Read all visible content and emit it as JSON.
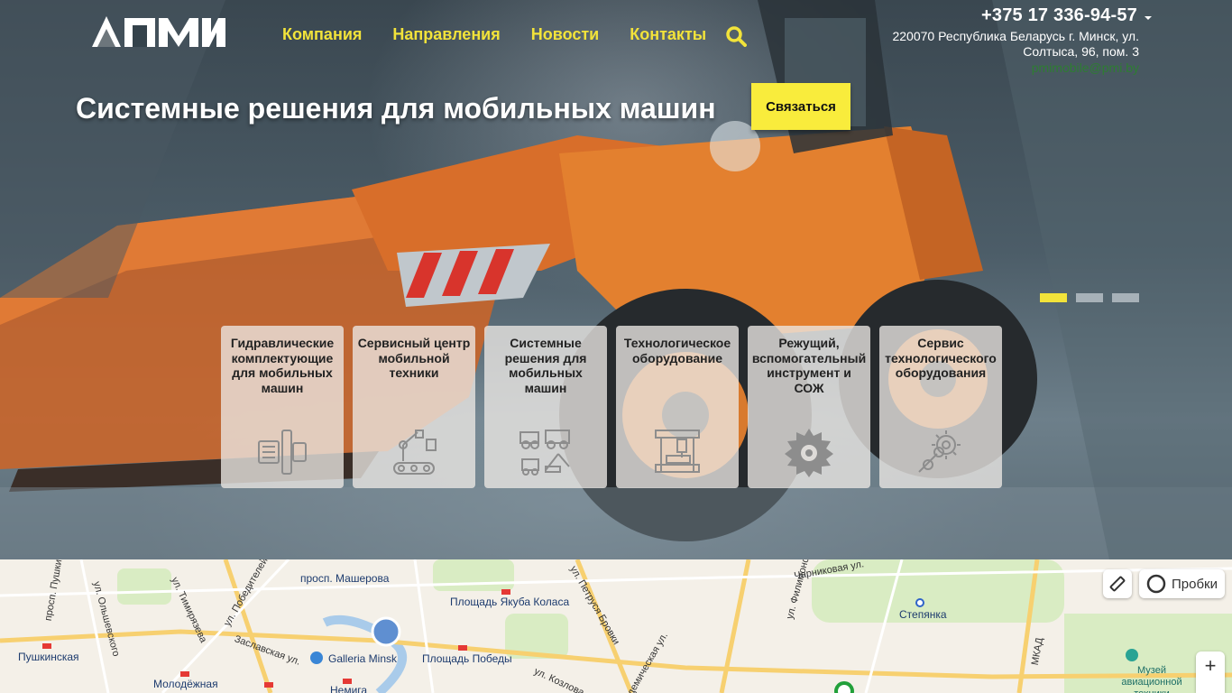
{
  "header": {
    "nav": [
      "Компания",
      "Направления",
      "Новости",
      "Контакты"
    ],
    "phone": "+375 17 336-94-57",
    "address": "220070 Республика Беларусь г. Минск, ул. Солтыса, 96, пом. 3",
    "email": "pmimobile@pmi.by"
  },
  "hero": {
    "title": "Системные решения для мобильных машин",
    "cta_label": "Связаться",
    "slides_count": 3,
    "active_slide": 1
  },
  "cards": [
    {
      "label": "Гидравлические комплектующие для мобильных машин",
      "icon": "hydraulic-pump-icon"
    },
    {
      "label": "Сервисный центр мобильной техники",
      "icon": "robot-arm-icon"
    },
    {
      "label": "Системные решения для мобильных машин",
      "icon": "vehicles-icon"
    },
    {
      "label": "Технологическое оборудование",
      "icon": "machine-tool-icon"
    },
    {
      "label": "Режущий, вспомогательный инструмент и СОЖ",
      "icon": "saw-blade-icon"
    },
    {
      "label": "Сервис технологического оборудования",
      "icon": "gear-wrench-icon"
    }
  ],
  "map": {
    "traffic_label": "Пробки",
    "zoom_in_label": "+",
    "labels": {
      "mashy": "просп. Машерова",
      "pobediteley": "ул. Победителей",
      "kolasa": "Площадь Якуба Коласа",
      "pobedy": "Площадь Победы",
      "galleria": "Galleria Minsk",
      "nemiga": "Немига",
      "molodezhnaya": "Молодёжная",
      "pushkinskaya": "Пушкинская",
      "stepyanka": "Степянка",
      "museum": "Музей авиационной техники",
      "mkad": "МКАД",
      "timiryazeva": "ул. Тимирязева",
      "zaslavskaya": "Заславская ул.",
      "kozlova": "ул. Козлова",
      "brovki": "ул. Петруся Бровки",
      "olshevskogo": "ул. Ольшевского",
      "pushkina": "просп. Пушкина",
      "yarkova": "Чарниковая ул.",
      "filimonova": "ул. Филимонова",
      "kulman": "Академическая ул."
    }
  },
  "colors": {
    "accent": "#f2e33a",
    "cta": "#f9ec3c",
    "email": "#2e7d32"
  }
}
